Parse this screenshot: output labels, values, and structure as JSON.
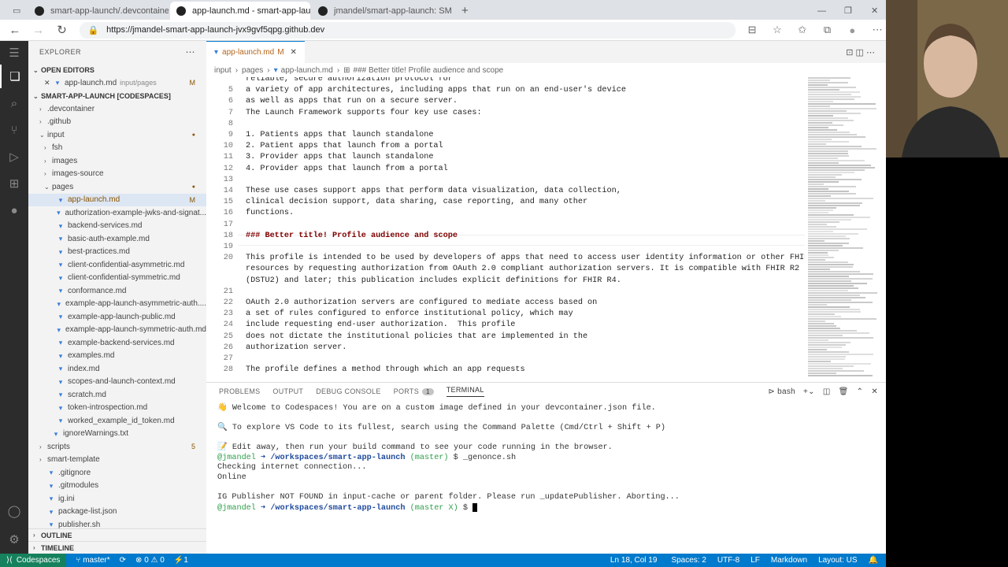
{
  "browser": {
    "tabs": [
      {
        "title": "smart-app-launch/.devcontainer",
        "active": false
      },
      {
        "title": "app-launch.md - smart-app-laun",
        "active": true
      },
      {
        "title": "jmandel/smart-app-launch: SMA",
        "active": false
      }
    ],
    "url": "https://jmandel-smart-app-launch-jvx9gvf5qpg.github.dev"
  },
  "sidebar": {
    "title": "EXPLORER",
    "open_editors_label": "OPEN EDITORS",
    "open_editor": {
      "name": "app-launch.md",
      "path": "input/pages",
      "badge": "M"
    },
    "workspace_label": "SMART-APP-LAUNCH [CODESPACES]",
    "tree": [
      {
        "name": ".devcontainer",
        "depth": 1,
        "folder": true,
        "open": false
      },
      {
        "name": ".github",
        "depth": 1,
        "folder": true,
        "open": false
      },
      {
        "name": "input",
        "depth": 1,
        "folder": true,
        "open": true,
        "dot": true
      },
      {
        "name": "fsh",
        "depth": 2,
        "folder": true,
        "open": false
      },
      {
        "name": "images",
        "depth": 2,
        "folder": true,
        "open": false
      },
      {
        "name": "images-source",
        "depth": 2,
        "folder": true,
        "open": false
      },
      {
        "name": "pages",
        "depth": 2,
        "folder": true,
        "open": true,
        "dot": true
      },
      {
        "name": "app-launch.md",
        "depth": 3,
        "folder": false,
        "selected": true,
        "badge": "M"
      },
      {
        "name": "authorization-example-jwks-and-signat...",
        "depth": 3,
        "folder": false
      },
      {
        "name": "backend-services.md",
        "depth": 3,
        "folder": false
      },
      {
        "name": "basic-auth-example.md",
        "depth": 3,
        "folder": false
      },
      {
        "name": "best-practices.md",
        "depth": 3,
        "folder": false
      },
      {
        "name": "client-confidential-asymmetric.md",
        "depth": 3,
        "folder": false
      },
      {
        "name": "client-confidential-symmetric.md",
        "depth": 3,
        "folder": false
      },
      {
        "name": "conformance.md",
        "depth": 3,
        "folder": false
      },
      {
        "name": "example-app-launch-asymmetric-auth....",
        "depth": 3,
        "folder": false
      },
      {
        "name": "example-app-launch-public.md",
        "depth": 3,
        "folder": false
      },
      {
        "name": "example-app-launch-symmetric-auth.md",
        "depth": 3,
        "folder": false
      },
      {
        "name": "example-backend-services.md",
        "depth": 3,
        "folder": false
      },
      {
        "name": "examples.md",
        "depth": 3,
        "folder": false
      },
      {
        "name": "index.md",
        "depth": 3,
        "folder": false
      },
      {
        "name": "scopes-and-launch-context.md",
        "depth": 3,
        "folder": false
      },
      {
        "name": "scratch.md",
        "depth": 3,
        "folder": false
      },
      {
        "name": "token-introspection.md",
        "depth": 3,
        "folder": false
      },
      {
        "name": "worked_example_id_token.md",
        "depth": 3,
        "folder": false
      },
      {
        "name": "ignoreWarnings.txt",
        "depth": 2,
        "folder": false
      },
      {
        "name": "scripts",
        "depth": 1,
        "folder": true,
        "open": false,
        "badge": "5"
      },
      {
        "name": "smart-template",
        "depth": 1,
        "folder": true,
        "open": false
      },
      {
        "name": ".gitignore",
        "depth": 1,
        "folder": false
      },
      {
        "name": ".gitmodules",
        "depth": 1,
        "folder": false
      },
      {
        "name": "ig.ini",
        "depth": 1,
        "folder": false
      },
      {
        "name": "package-list.json",
        "depth": 1,
        "folder": false
      },
      {
        "name": "publisher.sh",
        "depth": 1,
        "folder": false
      }
    ],
    "outline_label": "OUTLINE",
    "timeline_label": "TIMELINE"
  },
  "editor": {
    "tab": {
      "name": "app-launch.md",
      "badge": "M"
    },
    "breadcrumb": [
      "input",
      "pages",
      "app-launch.md",
      "### Better title! Profile audience and scope"
    ],
    "lines": [
      {
        "n": "",
        "t": "reliable, secure authorization protocol for"
      },
      {
        "n": "5",
        "t": "a variety of app architectures, including apps that run on an end-user's device"
      },
      {
        "n": "6",
        "t": "as well as apps that run on a secure server."
      },
      {
        "n": "7",
        "t": "The Launch Framework supports four key use cases:"
      },
      {
        "n": "8",
        "t": ""
      },
      {
        "n": "9",
        "t": "1. Patients apps that launch standalone"
      },
      {
        "n": "10",
        "t": "2. Patient apps that launch from a portal"
      },
      {
        "n": "11",
        "t": "3. Provider apps that launch standalone"
      },
      {
        "n": "12",
        "t": "4. Provider apps that launch from a portal"
      },
      {
        "n": "13",
        "t": ""
      },
      {
        "n": "14",
        "t": "These use cases support apps that perform data visualization, data collection,"
      },
      {
        "n": "15",
        "t": "clinical decision support, data sharing, case reporting, and many other"
      },
      {
        "n": "16",
        "t": "functions."
      },
      {
        "n": "17",
        "t": ""
      },
      {
        "n": "18",
        "t": "### Better title! Profile audience and scope",
        "h": true
      },
      {
        "n": "19",
        "t": ""
      },
      {
        "n": "20",
        "t": "This profile is intended to be used by developers of apps that need to access user identity information or other FHIR"
      },
      {
        "n": "",
        "t": "resources by requesting authorization from OAuth 2.0 compliant authorization servers. It is compatible with FHIR R2"
      },
      {
        "n": "",
        "t": "(DSTU2) and later; this publication includes explicit definitions for FHIR R4."
      },
      {
        "n": "21",
        "t": ""
      },
      {
        "n": "22",
        "t": "OAuth 2.0 authorization servers are configured to mediate access based on"
      },
      {
        "n": "23",
        "t": "a set of rules configured to enforce institutional policy, which may"
      },
      {
        "n": "24",
        "t": "include requesting end-user authorization.  This profile"
      },
      {
        "n": "25",
        "t": "does not dictate the institutional policies that are implemented in the"
      },
      {
        "n": "26",
        "t": "authorization server."
      },
      {
        "n": "27",
        "t": ""
      },
      {
        "n": "28",
        "t": "The profile defines a method through which an app requests"
      }
    ]
  },
  "panel": {
    "tabs": [
      "PROBLEMS",
      "OUTPUT",
      "DEBUG CONSOLE",
      "PORTS",
      "TERMINAL"
    ],
    "ports_count": "1",
    "shell": "bash",
    "terminal": {
      "welcome": "Welcome to Codespaces! You are on a custom image defined in your devcontainer.json file.",
      "explore": "To explore VS Code to its fullest, search using the Command Palette (Cmd/Ctrl + Shift + P)",
      "edit": "Edit away, then run your build command to see your code running in the browser.",
      "user": "@jmandel",
      "arrow": "➜",
      "path": "/workspaces/smart-app-launch",
      "branch1": "(master)",
      "cmd": "$ _genonce.sh",
      "check": "Checking internet connection...",
      "online": "Online",
      "error": "IG Publisher NOT FOUND in input-cache or parent folder. Please run _updatePublisher. Aborting...",
      "branch2": "(master X)",
      "prompt": "$"
    }
  },
  "status": {
    "remote": "Codespaces",
    "branch": "master*",
    "errors": "0",
    "warnings": "0",
    "ports": "1",
    "position": "Ln 18, Col 19",
    "spaces": "Spaces: 2",
    "encoding": "UTF-8",
    "eol": "LF",
    "language": "Markdown",
    "layout": "Layout: US"
  },
  "colors": {
    "accent": "#007acc",
    "remote": "#16825d",
    "modified": "#895503",
    "heading": "#800000"
  }
}
